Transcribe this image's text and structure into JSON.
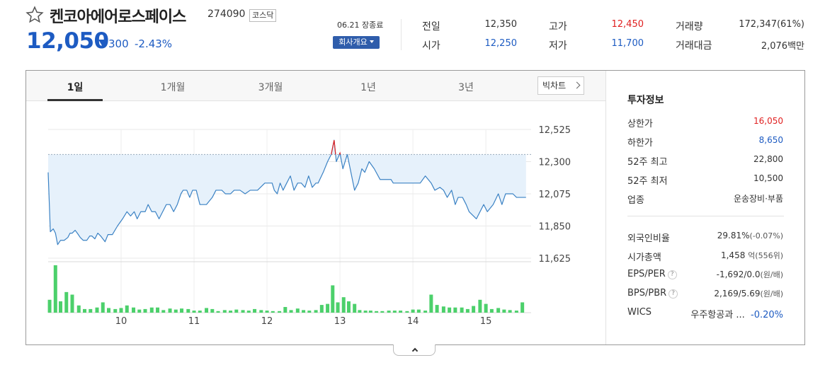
{
  "header": {
    "name": "켄코아에어로스페이스",
    "code": "274090",
    "market": "코스닥",
    "price": "12,050",
    "change": "300",
    "change_pct": "-2.43%",
    "date_status": "06.21 장종료",
    "company_btn": "회사개요",
    "direction_color": "#1d5bc2"
  },
  "quote": {
    "prev_label": "전일",
    "prev_value": "12,350",
    "open_label": "시가",
    "open_value": "12,250",
    "high_label": "고가",
    "high_value": "12,450",
    "low_label": "저가",
    "low_value": "11,700",
    "volume_label": "거래량",
    "volume_value": "172,347(61%)",
    "amount_label": "거래대금",
    "amount_value": "2,076백만"
  },
  "tabs": [
    {
      "label": "1일",
      "active": true
    },
    {
      "label": "1개월",
      "active": false
    },
    {
      "label": "3개월",
      "active": false
    },
    {
      "label": "1년",
      "active": false
    },
    {
      "label": "3년",
      "active": false
    }
  ],
  "big_chart_label": "빅차트",
  "side": {
    "title": "투자정보",
    "upper_limit_label": "상한가",
    "upper_limit": "16,050",
    "lower_limit_label": "하한가",
    "lower_limit": "8,650",
    "high52_label": "52주 최고",
    "high52": "22,800",
    "low52_label": "52주 최저",
    "low52": "10,500",
    "sector_label": "업종",
    "sector": "운송장비·부품",
    "foreign_label": "외국인비율",
    "foreign": "29.81%",
    "foreign_change": "(-0.07%)",
    "mcap_label": "시가총액",
    "mcap": "1,458",
    "mcap_unit": "억(556위)",
    "eps_label": "EPS/PER",
    "eps": "-1,692/0.0",
    "eps_unit": "(원/배)",
    "bps_label": "BPS/PBR",
    "bps": "2,169/5.69",
    "bps_unit": "(원/배)",
    "wics_label": "WICS",
    "wics": "우주항공과 ...",
    "wics_change": "-0.20%",
    "help_mark": "?"
  },
  "chart_data": {
    "type": "line",
    "x_ticks": [
      "10",
      "11",
      "12",
      "13",
      "14",
      "15"
    ],
    "x_tick_times": [
      1,
      2,
      3,
      4,
      5,
      6
    ],
    "y_ticks": [
      "12,525",
      "12,300",
      "12,075",
      "11,850",
      "11,625"
    ],
    "y_tick_values": [
      12525,
      12300,
      12075,
      11850,
      11625
    ],
    "ylim": [
      11625,
      12525
    ],
    "reference_price": 12350,
    "grid": true,
    "line_color": "#3b82c4",
    "fill_color": "#e6f1fb",
    "volume_color": "#4cd06b",
    "price_high": 12450,
    "price": [
      {
        "t": 0.0,
        "v": 12225
      },
      {
        "t": 0.03,
        "v": 11810
      },
      {
        "t": 0.07,
        "v": 11830
      },
      {
        "t": 0.1,
        "v": 11800
      },
      {
        "t": 0.13,
        "v": 11720
      },
      {
        "t": 0.17,
        "v": 11750
      },
      {
        "t": 0.22,
        "v": 11750
      },
      {
        "t": 0.27,
        "v": 11770
      },
      {
        "t": 0.3,
        "v": 11800
      },
      {
        "t": 0.33,
        "v": 11800
      },
      {
        "t": 0.37,
        "v": 11820
      },
      {
        "t": 0.4,
        "v": 11800
      },
      {
        "t": 0.44,
        "v": 11770
      },
      {
        "t": 0.48,
        "v": 11750
      },
      {
        "t": 0.53,
        "v": 11750
      },
      {
        "t": 0.57,
        "v": 11780
      },
      {
        "t": 0.6,
        "v": 11780
      },
      {
        "t": 0.64,
        "v": 11760
      },
      {
        "t": 0.68,
        "v": 11800
      },
      {
        "t": 0.72,
        "v": 11780
      },
      {
        "t": 0.78,
        "v": 11740
      },
      {
        "t": 0.82,
        "v": 11790
      },
      {
        "t": 0.88,
        "v": 11790
      },
      {
        "t": 0.95,
        "v": 11850
      },
      {
        "t": 1.02,
        "v": 11900
      },
      {
        "t": 1.08,
        "v": 11950
      },
      {
        "t": 1.13,
        "v": 11920
      },
      {
        "t": 1.18,
        "v": 11950
      },
      {
        "t": 1.22,
        "v": 11900
      },
      {
        "t": 1.27,
        "v": 11950
      },
      {
        "t": 1.33,
        "v": 11950
      },
      {
        "t": 1.37,
        "v": 12000
      },
      {
        "t": 1.42,
        "v": 11950
      },
      {
        "t": 1.47,
        "v": 11950
      },
      {
        "t": 1.52,
        "v": 11900
      },
      {
        "t": 1.57,
        "v": 11950
      },
      {
        "t": 1.62,
        "v": 12000
      },
      {
        "t": 1.67,
        "v": 12000
      },
      {
        "t": 1.72,
        "v": 11950
      },
      {
        "t": 1.77,
        "v": 12000
      },
      {
        "t": 1.82,
        "v": 12075
      },
      {
        "t": 1.85,
        "v": 12100
      },
      {
        "t": 1.9,
        "v": 12100
      },
      {
        "t": 1.94,
        "v": 12050
      },
      {
        "t": 1.98,
        "v": 12100
      },
      {
        "t": 2.03,
        "v": 12100
      },
      {
        "t": 2.08,
        "v": 12000
      },
      {
        "t": 2.17,
        "v": 12000
      },
      {
        "t": 2.25,
        "v": 12050
      },
      {
        "t": 2.3,
        "v": 12100
      },
      {
        "t": 2.38,
        "v": 12100
      },
      {
        "t": 2.43,
        "v": 12075
      },
      {
        "t": 2.5,
        "v": 12075
      },
      {
        "t": 2.55,
        "v": 12100
      },
      {
        "t": 2.63,
        "v": 12100
      },
      {
        "t": 2.7,
        "v": 12075
      },
      {
        "t": 2.77,
        "v": 12100
      },
      {
        "t": 2.87,
        "v": 12100
      },
      {
        "t": 2.97,
        "v": 12150
      },
      {
        "t": 3.07,
        "v": 12150
      },
      {
        "t": 3.1,
        "v": 12100
      },
      {
        "t": 3.14,
        "v": 12075
      },
      {
        "t": 3.18,
        "v": 12150
      },
      {
        "t": 3.22,
        "v": 12100
      },
      {
        "t": 3.27,
        "v": 12150
      },
      {
        "t": 3.32,
        "v": 12200
      },
      {
        "t": 3.37,
        "v": 12100
      },
      {
        "t": 3.42,
        "v": 12150
      },
      {
        "t": 3.47,
        "v": 12150
      },
      {
        "t": 3.52,
        "v": 12120
      },
      {
        "t": 3.57,
        "v": 12200
      },
      {
        "t": 3.62,
        "v": 12120
      },
      {
        "t": 3.67,
        "v": 12150
      },
      {
        "t": 3.7,
        "v": 12150
      },
      {
        "t": 3.77,
        "v": 12225
      },
      {
        "t": 3.83,
        "v": 12300
      },
      {
        "t": 3.88,
        "v": 12350
      },
      {
        "t": 3.92,
        "v": 12450
      },
      {
        "t": 3.95,
        "v": 12300
      },
      {
        "t": 4.0,
        "v": 12360
      },
      {
        "t": 4.04,
        "v": 12250
      },
      {
        "t": 4.1,
        "v": 12350
      },
      {
        "t": 4.15,
        "v": 12225
      },
      {
        "t": 4.2,
        "v": 12100
      },
      {
        "t": 4.25,
        "v": 12150
      },
      {
        "t": 4.3,
        "v": 12250
      },
      {
        "t": 4.34,
        "v": 12225
      },
      {
        "t": 4.4,
        "v": 12300
      },
      {
        "t": 4.47,
        "v": 12250
      },
      {
        "t": 4.55,
        "v": 12175
      },
      {
        "t": 4.7,
        "v": 12175
      },
      {
        "t": 4.73,
        "v": 12150
      },
      {
        "t": 4.85,
        "v": 12150
      },
      {
        "t": 5.0,
        "v": 12150
      },
      {
        "t": 5.1,
        "v": 12150
      },
      {
        "t": 5.17,
        "v": 12200
      },
      {
        "t": 5.25,
        "v": 12150
      },
      {
        "t": 5.3,
        "v": 12100
      },
      {
        "t": 5.37,
        "v": 12120
      },
      {
        "t": 5.42,
        "v": 12100
      },
      {
        "t": 5.47,
        "v": 12050
      },
      {
        "t": 5.53,
        "v": 12100
      },
      {
        "t": 5.58,
        "v": 12000
      },
      {
        "t": 5.62,
        "v": 12050
      },
      {
        "t": 5.68,
        "v": 12050
      },
      {
        "t": 5.73,
        "v": 12000
      },
      {
        "t": 5.77,
        "v": 11950
      },
      {
        "t": 5.87,
        "v": 11900
      },
      {
        "t": 5.92,
        "v": 11950
      },
      {
        "t": 5.97,
        "v": 12000
      },
      {
        "t": 6.02,
        "v": 11950
      },
      {
        "t": 6.1,
        "v": 12000
      },
      {
        "t": 6.17,
        "v": 12075
      },
      {
        "t": 6.22,
        "v": 12000
      },
      {
        "t": 6.27,
        "v": 12075
      },
      {
        "t": 6.37,
        "v": 12075
      },
      {
        "t": 6.42,
        "v": 12050
      },
      {
        "t": 6.55,
        "v": 12050
      }
    ],
    "volume": [
      {
        "t": 0.02,
        "v": 25
      },
      {
        "t": 0.1,
        "v": 92
      },
      {
        "t": 0.17,
        "v": 22
      },
      {
        "t": 0.25,
        "v": 40
      },
      {
        "t": 0.33,
        "v": 35
      },
      {
        "t": 0.42,
        "v": 14
      },
      {
        "t": 0.5,
        "v": 7
      },
      {
        "t": 0.58,
        "v": 7
      },
      {
        "t": 0.67,
        "v": 10
      },
      {
        "t": 0.75,
        "v": 20
      },
      {
        "t": 0.83,
        "v": 9
      },
      {
        "t": 0.92,
        "v": 7
      },
      {
        "t": 1.0,
        "v": 9
      },
      {
        "t": 1.08,
        "v": 14
      },
      {
        "t": 1.17,
        "v": 10
      },
      {
        "t": 1.25,
        "v": 6
      },
      {
        "t": 1.33,
        "v": 7
      },
      {
        "t": 1.42,
        "v": 10
      },
      {
        "t": 1.5,
        "v": 10
      },
      {
        "t": 1.58,
        "v": 5
      },
      {
        "t": 1.67,
        "v": 8
      },
      {
        "t": 1.75,
        "v": 6
      },
      {
        "t": 1.83,
        "v": 8
      },
      {
        "t": 1.92,
        "v": 7
      },
      {
        "t": 2.0,
        "v": 4
      },
      {
        "t": 2.08,
        "v": 4
      },
      {
        "t": 2.17,
        "v": 9
      },
      {
        "t": 2.25,
        "v": 7
      },
      {
        "t": 2.33,
        "v": 3
      },
      {
        "t": 2.42,
        "v": 5
      },
      {
        "t": 2.5,
        "v": 4
      },
      {
        "t": 2.58,
        "v": 6
      },
      {
        "t": 2.67,
        "v": 5
      },
      {
        "t": 2.75,
        "v": 4
      },
      {
        "t": 2.83,
        "v": 7
      },
      {
        "t": 2.92,
        "v": 5
      },
      {
        "t": 3.0,
        "v": 4
      },
      {
        "t": 3.08,
        "v": 3
      },
      {
        "t": 3.17,
        "v": 3
      },
      {
        "t": 3.25,
        "v": 11
      },
      {
        "t": 3.33,
        "v": 5
      },
      {
        "t": 3.42,
        "v": 8
      },
      {
        "t": 3.5,
        "v": 5
      },
      {
        "t": 3.58,
        "v": 4
      },
      {
        "t": 3.67,
        "v": 5
      },
      {
        "t": 3.75,
        "v": 15
      },
      {
        "t": 3.83,
        "v": 17
      },
      {
        "t": 3.9,
        "v": 53
      },
      {
        "t": 3.97,
        "v": 20
      },
      {
        "t": 4.05,
        "v": 30
      },
      {
        "t": 4.12,
        "v": 22
      },
      {
        "t": 4.2,
        "v": 17
      },
      {
        "t": 4.27,
        "v": 5
      },
      {
        "t": 4.35,
        "v": 4
      },
      {
        "t": 4.42,
        "v": 4
      },
      {
        "t": 4.5,
        "v": 3
      },
      {
        "t": 4.58,
        "v": 3
      },
      {
        "t": 4.67,
        "v": 4
      },
      {
        "t": 4.75,
        "v": 4
      },
      {
        "t": 4.83,
        "v": 4
      },
      {
        "t": 4.92,
        "v": 3
      },
      {
        "t": 5.0,
        "v": 6
      },
      {
        "t": 5.08,
        "v": 6
      },
      {
        "t": 5.17,
        "v": 4
      },
      {
        "t": 5.25,
        "v": 35
      },
      {
        "t": 5.33,
        "v": 15
      },
      {
        "t": 5.42,
        "v": 12
      },
      {
        "t": 5.5,
        "v": 10
      },
      {
        "t": 5.58,
        "v": 10
      },
      {
        "t": 5.67,
        "v": 10
      },
      {
        "t": 5.75,
        "v": 7
      },
      {
        "t": 5.83,
        "v": 13
      },
      {
        "t": 5.92,
        "v": 25
      },
      {
        "t": 6.0,
        "v": 17
      },
      {
        "t": 6.08,
        "v": 7
      },
      {
        "t": 6.17,
        "v": 9
      },
      {
        "t": 6.25,
        "v": 6
      },
      {
        "t": 6.33,
        "v": 5
      },
      {
        "t": 6.42,
        "v": 4
      },
      {
        "t": 6.5,
        "v": 20
      }
    ]
  }
}
